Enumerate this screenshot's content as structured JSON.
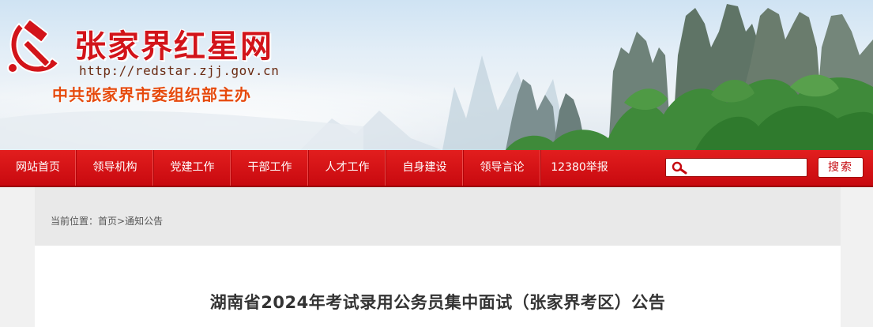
{
  "header": {
    "site_title": "张家界红星网",
    "site_url": "http://redstar.zjj.gov.cn",
    "host_org": "中共张家界市委组织部主办"
  },
  "nav": {
    "items": [
      {
        "label": "网站首页"
      },
      {
        "label": "领导机构"
      },
      {
        "label": "党建工作"
      },
      {
        "label": "干部工作"
      },
      {
        "label": "人才工作"
      },
      {
        "label": "自身建设"
      },
      {
        "label": "领导言论"
      },
      {
        "label": "12380举报"
      }
    ]
  },
  "search": {
    "value": "",
    "placeholder": "",
    "button_label": "搜索",
    "icon": "search-icon"
  },
  "breadcrumb": {
    "prefix": "当前位置：",
    "home": "首页",
    "separator": ">",
    "current": "通知公告"
  },
  "article": {
    "title": "湖南省2024年考试录用公务员集中面试（张家界考区）公告"
  },
  "colors": {
    "brand_red": "#d2141a",
    "nav_red": "#c8090f",
    "host_orange": "#e64a0d"
  }
}
